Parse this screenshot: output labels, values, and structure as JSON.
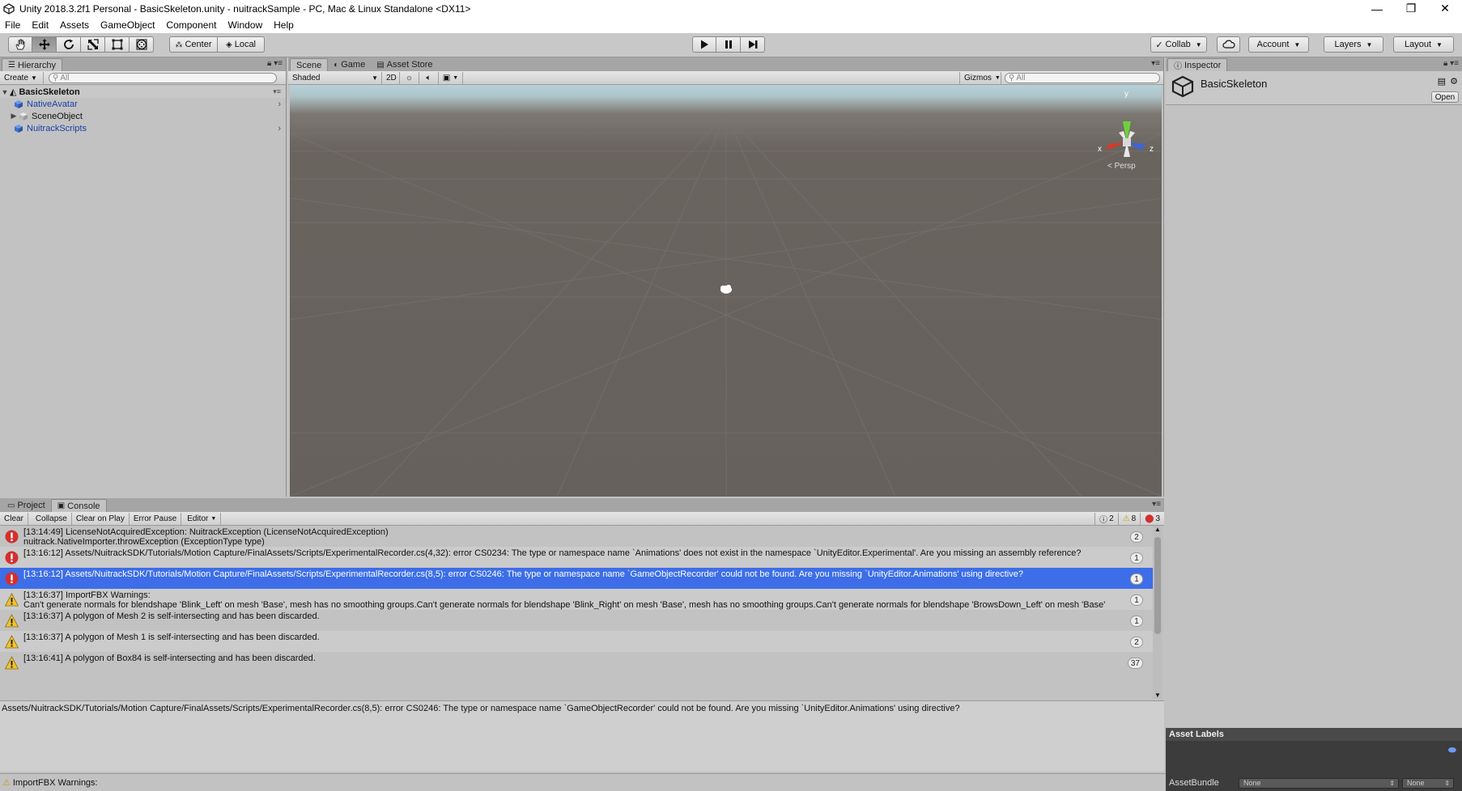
{
  "window": {
    "title": "Unity 2018.3.2f1 Personal - BasicSkeleton.unity - nuitrackSample - PC, Mac & Linux Standalone <DX11>",
    "controls": [
      "—",
      "❐",
      "✕"
    ]
  },
  "menu": [
    "File",
    "Edit",
    "Assets",
    "GameObject",
    "Component",
    "Window",
    "Help"
  ],
  "toolbar": {
    "pivot": "Center",
    "space": "Local",
    "collab": "Collab",
    "account": "Account",
    "layers": "Layers",
    "layout": "Layout"
  },
  "hierarchy": {
    "tab": "Hierarchy",
    "create": "Create",
    "search_placeholder": "All",
    "scene_name": "BasicSkeleton",
    "items": [
      "NativeAvatar",
      "SceneObject",
      "NuitrackScripts"
    ]
  },
  "scene": {
    "tabs": [
      "Scene",
      "Game",
      "Asset Store"
    ],
    "shading": "Shaded",
    "mode_2d": "2D",
    "gizmos": "Gizmos",
    "search_placeholder": "All",
    "projection": "Persp",
    "axis_x": "x",
    "axis_y": "y",
    "axis_z": "z"
  },
  "inspector": {
    "tab": "Inspector",
    "object_name": "BasicSkeleton",
    "open": "Open",
    "asset_labels": "Asset Labels",
    "asset_bundle": "AssetBundle",
    "bundle_name": "None",
    "bundle_variant": "None"
  },
  "console": {
    "tabs": [
      "Project",
      "Console"
    ],
    "buttons": [
      "Clear",
      "Collapse",
      "Clear on Play",
      "Error Pause"
    ],
    "editor": "Editor",
    "counts": {
      "info": "2",
      "warn": "8",
      "error": "3"
    },
    "rows": [
      {
        "type": "error",
        "line1": "[13:14:49] LicenseNotAcquiredException: NuitrackException (LicenseNotAcquiredException)",
        "line2": "nuitrack.NativeImporter.throwException (ExceptionType type)",
        "count": "2"
      },
      {
        "type": "error",
        "line1": "[13:16:12] Assets/NuitrackSDK/Tutorials/Motion Capture/FinalAssets/Scripts/ExperimentalRecorder.cs(4,32): error CS0234: The type or namespace name `Animations' does not exist in the namespace `UnityEditor.Experimental'. Are you missing an assembly reference?",
        "line2": "",
        "count": "1"
      },
      {
        "type": "error",
        "line1": "[13:16:12] Assets/NuitrackSDK/Tutorials/Motion Capture/FinalAssets/Scripts/ExperimentalRecorder.cs(8,5): error CS0246: The type or namespace name `GameObjectRecorder' could not be found. Are you missing `UnityEditor.Animations' using directive?",
        "line2": "",
        "count": "1"
      },
      {
        "type": "warn",
        "line1": "[13:16:37] ImportFBX Warnings:",
        "line2": "Can't generate normals for blendshape 'Blink_Left' on mesh 'Base', mesh has no smoothing groups.Can't generate normals for blendshape 'Blink_Right' on mesh 'Base', mesh has no smoothing groups.Can't generate normals for blendshape 'BrowsDown_Left' on mesh 'Base'",
        "count": "1"
      },
      {
        "type": "warn",
        "line1": "[13:16:37] A polygon of Mesh 2 is self-intersecting and has been discarded.",
        "line2": "",
        "count": "1"
      },
      {
        "type": "warn",
        "line1": "[13:16:37] A polygon of Mesh 1 is self-intersecting and has been discarded.",
        "line2": "",
        "count": "2"
      },
      {
        "type": "warn",
        "line1": "[13:16:41] A polygon of Box84 is self-intersecting and has been discarded.",
        "line2": "",
        "count": "37"
      }
    ],
    "detail": "Assets/NuitrackSDK/Tutorials/Motion Capture/FinalAssets/Scripts/ExperimentalRecorder.cs(8,5): error CS0246: The type or namespace name `GameObjectRecorder' could not be found. Are you missing `UnityEditor.Animations' using directive?"
  },
  "status": "ImportFBX Warnings:",
  "colors": {
    "selection": "#3d6ee8",
    "error": "#d32f2f",
    "warning": "#f2c230",
    "prefab": "#1b3ea8"
  }
}
